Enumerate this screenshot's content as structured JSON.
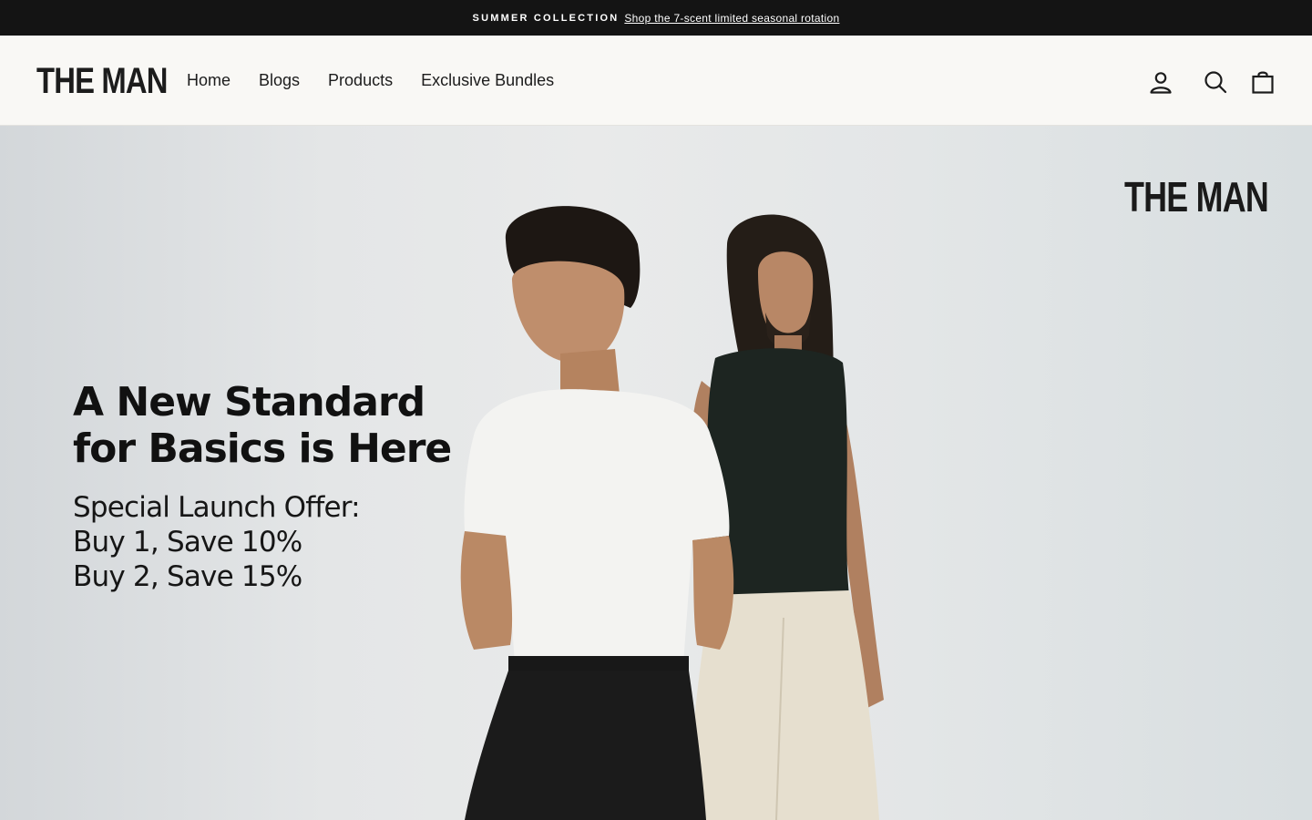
{
  "announcement": {
    "tag": "SUMMER COLLECTION",
    "link_text": "Shop the 7-scent limited seasonal rotation"
  },
  "header": {
    "logo": "THE MAN",
    "nav": [
      "Home",
      "Blogs",
      "Products",
      "Exclusive Bundles"
    ],
    "icons": [
      "account-icon",
      "search-icon",
      "cart-icon"
    ]
  },
  "hero": {
    "logo": "THE MAN",
    "headline_line1": "A New Standard",
    "headline_line2": "for Basics is Here",
    "offer_line1": "Special Launch Offer:",
    "offer_line2": "Buy 1, Save 10%",
    "offer_line3": "Buy 2, Save 15%"
  }
}
